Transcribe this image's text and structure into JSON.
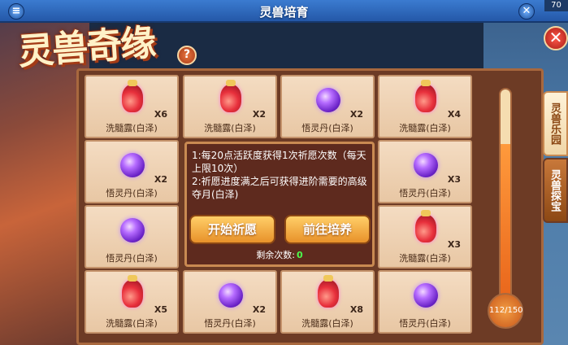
{
  "window": {
    "title": "灵兽培育",
    "level": "70"
  },
  "event_title": "灵兽奇缘",
  "help_label": "?",
  "close_label": "✕",
  "side_tabs": [
    {
      "label": "灵兽乐园"
    },
    {
      "label": "灵兽探宝"
    }
  ],
  "grid": [
    {
      "name": "洗髓露(白泽)",
      "qty": "X6",
      "icon": "bottle-icon"
    },
    {
      "name": "洗髓露(白泽)",
      "qty": "X2",
      "icon": "bottle-icon"
    },
    {
      "name": "悟灵丹(白泽)",
      "qty": "X2",
      "icon": "orb-icon"
    },
    {
      "name": "洗髓露(白泽)",
      "qty": "X4",
      "icon": "bottle-icon"
    },
    {
      "name": "悟灵丹(白泽)",
      "qty": "X2",
      "icon": "orb-icon"
    },
    {
      "name": "悟灵丹(白泽)",
      "qty": "X3",
      "icon": "orb-icon"
    },
    {
      "name": "悟灵丹(白泽)",
      "qty": "",
      "icon": "orb-icon"
    },
    {
      "name": "洗髓露(白泽)",
      "qty": "X3",
      "icon": "bottle-icon"
    },
    {
      "name": "洗髓露(白泽)",
      "qty": "X5",
      "icon": "bottle-icon"
    },
    {
      "name": "悟灵丹(白泽)",
      "qty": "X2",
      "icon": "orb-icon"
    },
    {
      "name": "洗髓露(白泽)",
      "qty": "X8",
      "icon": "bottle-icon"
    },
    {
      "name": "悟灵丹(白泽)",
      "qty": "",
      "icon": "orb-icon"
    }
  ],
  "info": {
    "line1": "1:每20点活跃度获得1次祈愿次数（每天上限10次）",
    "line2": "2:祈愿进度满之后可获得进阶需要的高级夺月(白泽)"
  },
  "buttons": {
    "start_wish": "开始祈愿",
    "go_cultivate": "前往培养"
  },
  "remaining": {
    "label": "剩余次数:",
    "count": "0"
  },
  "progress": {
    "label": "112/150",
    "current": 112,
    "max": 150
  }
}
